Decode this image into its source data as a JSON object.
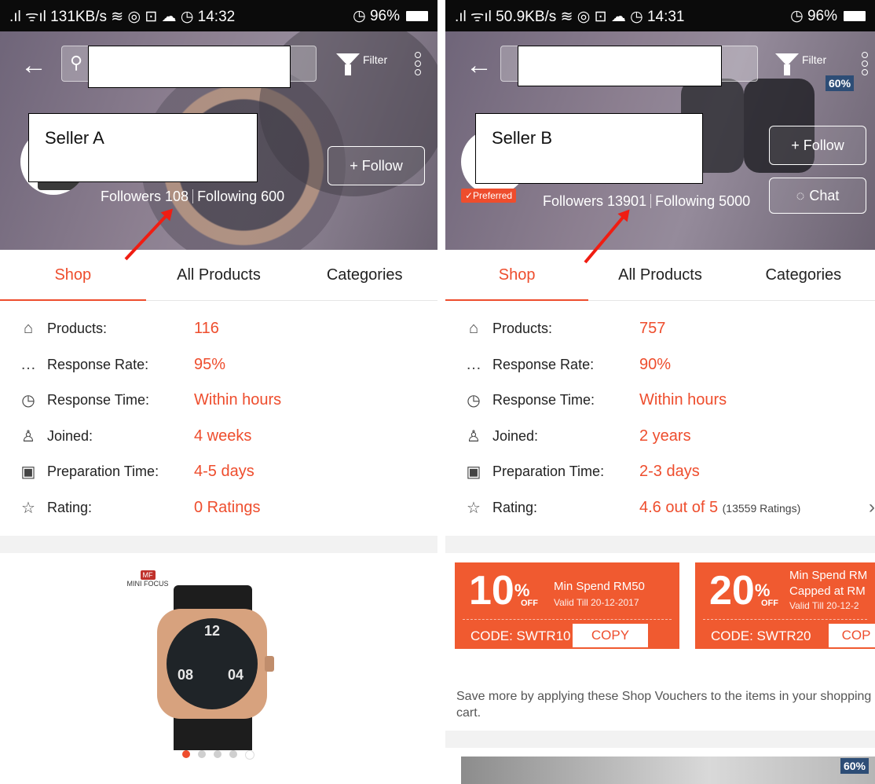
{
  "left": {
    "status_left": ".ıl ᯤıl 131KB/s ≋ ◎ ⊡ ☁ ◷  14:32",
    "status_right": "◷ 96%",
    "seller_name": "Seller A",
    "followers_label": "Followers 108",
    "following_label": "Following 600",
    "follow_label": "+ Follow",
    "filter_label": "Filter",
    "tabs": [
      "Shop",
      "All Products",
      "Categories"
    ],
    "info": [
      {
        "icon": "store-icon",
        "glyph": "⌂",
        "label": "Products:",
        "value": "116"
      },
      {
        "icon": "chat-bubble-icon",
        "glyph": "…",
        "label": "Response Rate:",
        "value": "95%"
      },
      {
        "icon": "clock-icon",
        "glyph": "◷",
        "label": "Response Time:",
        "value": "Within hours"
      },
      {
        "icon": "user-icon",
        "glyph": "♙",
        "label": "Joined:",
        "value": "4 weeks"
      },
      {
        "icon": "calendar-icon",
        "glyph": "▣",
        "label": "Preparation Time:",
        "value": "4-5 days"
      },
      {
        "icon": "star-icon",
        "glyph": "☆",
        "label": "Rating:",
        "value": "0 Ratings"
      }
    ],
    "brand": "MINI FOCUS",
    "brand_badge": "MF",
    "watch_numbers": [
      "12",
      "08",
      "04"
    ]
  },
  "right": {
    "status_left": ".ıl ᯤıl 50.9KB/s ≋ ◎ ⊡ ☁ ◷  14:31",
    "status_right": "◷ 96%",
    "seller_name": "Seller B",
    "preferred_label": "✓Preferred",
    "followers_label": "Followers 13901",
    "following_label": "Following 5000",
    "follow_label": "+ Follow",
    "chat_label": "Chat",
    "filter_label": "Filter",
    "promo": "60%",
    "tabs": [
      "Shop",
      "All Products",
      "Categories"
    ],
    "info": [
      {
        "icon": "store-icon",
        "glyph": "⌂",
        "label": "Products:",
        "value": "757"
      },
      {
        "icon": "chat-bubble-icon",
        "glyph": "…",
        "label": "Response Rate:",
        "value": "90%"
      },
      {
        "icon": "clock-icon",
        "glyph": "◷",
        "label": "Response Time:",
        "value": "Within hours"
      },
      {
        "icon": "user-icon",
        "glyph": "♙",
        "label": "Joined:",
        "value": "2 years"
      },
      {
        "icon": "calendar-icon",
        "glyph": "▣",
        "label": "Preparation Time:",
        "value": "2-3 days"
      },
      {
        "icon": "star-icon",
        "glyph": "☆",
        "label": "Rating:",
        "value": "4.6 out of 5",
        "sub": "(13559 Ratings)"
      }
    ],
    "vouchers": [
      {
        "pct": "10",
        "off": "OFF",
        "min": "Min Spend RM50",
        "valid": "Valid Till 20-12-2017",
        "code": "CODE: SWTR10",
        "copy": "COPY"
      },
      {
        "pct": "20",
        "off": "OFF",
        "min": "Min Spend RM",
        "min2": "Capped at RM",
        "valid": "Valid Till 20-12-2",
        "code": "CODE: SWTR20",
        "copy": "COP"
      }
    ],
    "save_more": "Save more by applying these Shop Vouchers to the items in your shopping cart.",
    "banner_promo": "60%"
  }
}
